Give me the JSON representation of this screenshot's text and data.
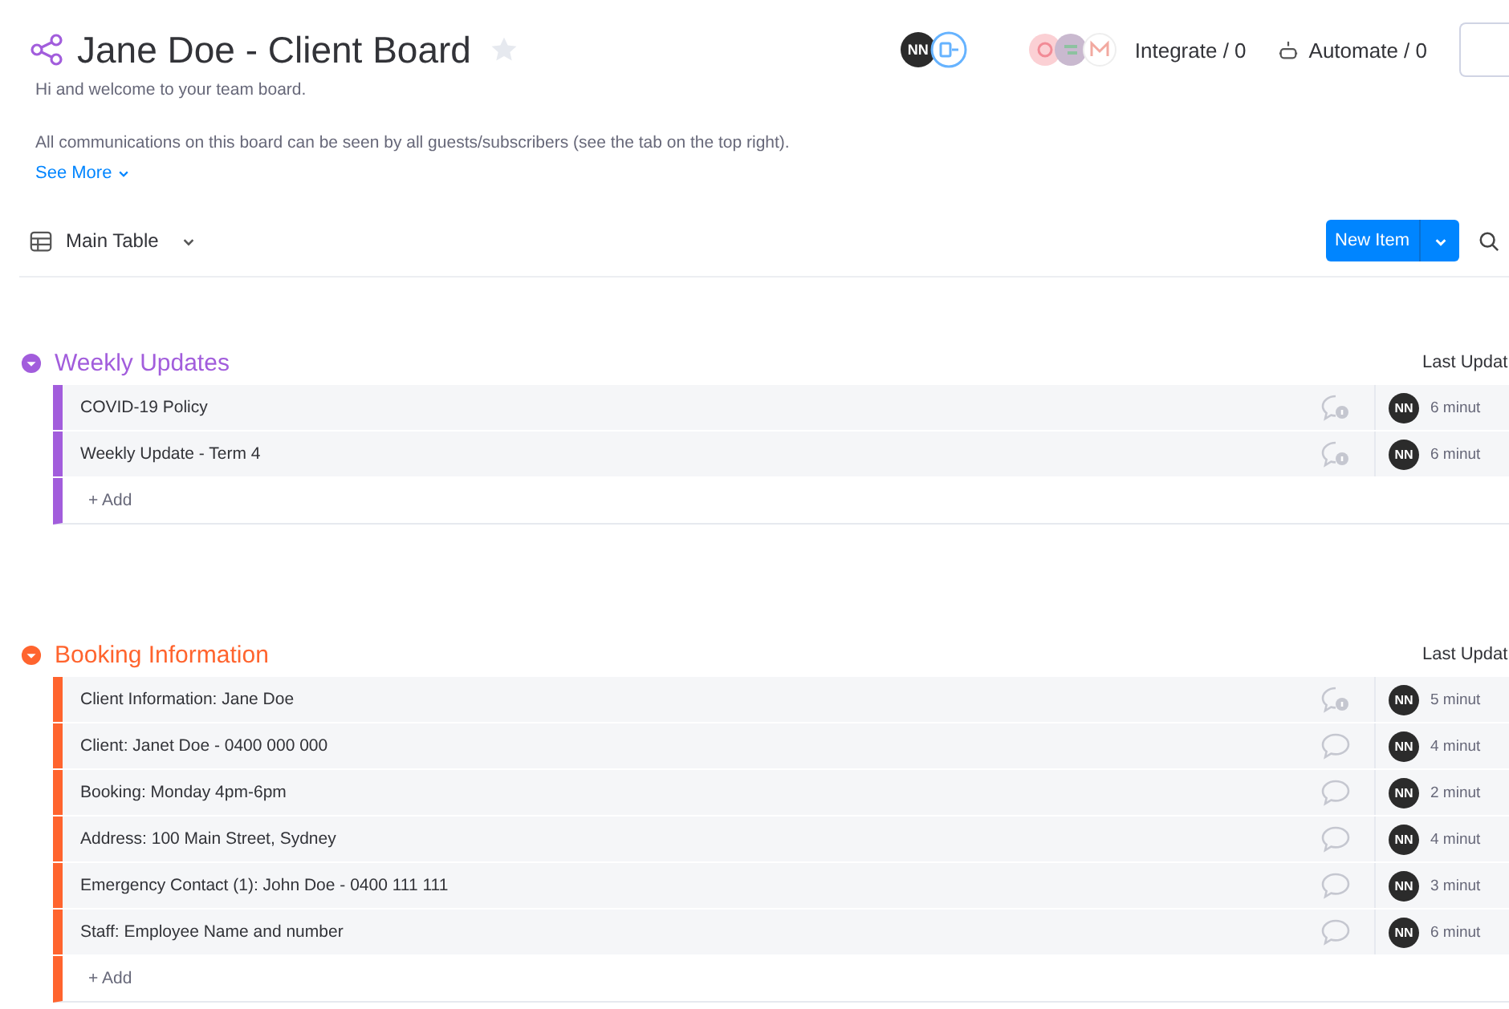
{
  "board": {
    "title": "Jane Doe - Client Board",
    "starred": false,
    "description": [
      "Hi and welcome to your team board.",
      "All communications on this board can be seen by all guests/subscribers (see the tab on the top right)."
    ],
    "see_more": "See More"
  },
  "header_actions": {
    "member": "NN",
    "integrate": "Integrate / 0",
    "automate": "Automate / 0"
  },
  "view": {
    "label": "Main Table"
  },
  "new_item": "New Item",
  "groups": [
    {
      "title": "Weekly Updates",
      "color": "#a25ddc",
      "column_header": "Last Updat",
      "add": "+ Add",
      "rows": [
        {
          "name": "COVID-19 Policy",
          "has_updates": true,
          "person": "NN",
          "updated": "6 minut"
        },
        {
          "name": "Weekly Update - Term 4",
          "has_updates": true,
          "person": "NN",
          "updated": "6 minut"
        }
      ]
    },
    {
      "title": "Booking Information",
      "color": "#ff642e",
      "column_header": "Last Updat",
      "add": "+ Add",
      "rows": [
        {
          "name": "Client Information: Jane Doe",
          "has_updates": true,
          "person": "NN",
          "updated": "5 minut"
        },
        {
          "name": "Client: Janet Doe - 0400 000 000",
          "has_updates": false,
          "person": "NN",
          "updated": "4 minut"
        },
        {
          "name": "Booking: Monday 4pm-6pm",
          "has_updates": false,
          "person": "NN",
          "updated": "2 minut"
        },
        {
          "name": "Address: 100 Main Street, Sydney",
          "has_updates": false,
          "person": "NN",
          "updated": "4 minut"
        },
        {
          "name": "Emergency Contact (1): John Doe - 0400 111 111",
          "has_updates": false,
          "person": "NN",
          "updated": "3 minut"
        },
        {
          "name": "Staff: Employee Name and number",
          "has_updates": false,
          "person": "NN",
          "updated": "6 minut"
        }
      ]
    }
  ]
}
